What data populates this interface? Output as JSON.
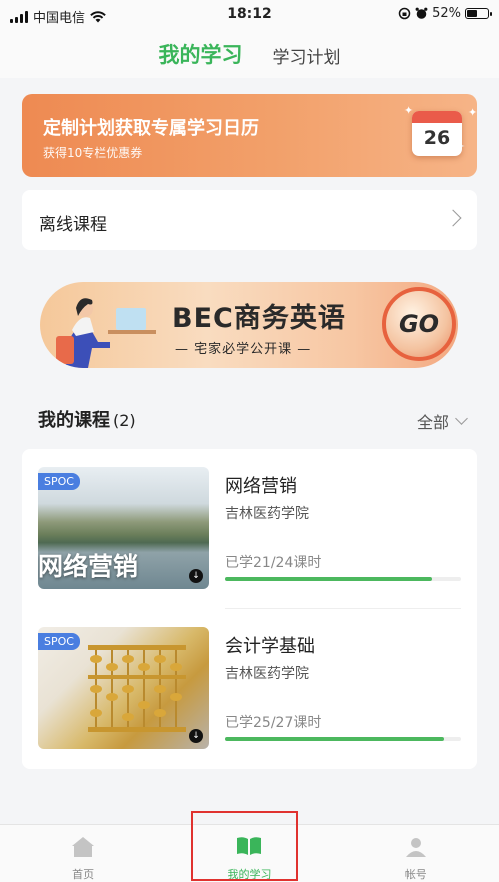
{
  "status_bar": {
    "carrier": "中国电信",
    "time": "18:12",
    "battery": "52%"
  },
  "top_tabs": {
    "active": "我的学习",
    "other": "学习计划"
  },
  "promo": {
    "title": "定制计划获取专属学习日历",
    "subtitle": "获得10专栏优惠券",
    "calendar_day": "26"
  },
  "offline": {
    "label": "离线课程"
  },
  "bec_banner": {
    "headline": "BEC商务英语",
    "subline": "— 宅家必学公开课 —",
    "go": "GO"
  },
  "section": {
    "title": "我的课程",
    "count": "(2)",
    "filter": "全部"
  },
  "courses": [
    {
      "tag": "SPOC",
      "thumb_title": "网络营销",
      "name": "网络营销",
      "school": "吉林医药学院",
      "progress_text": "已学21/24课时",
      "progress": 0.875
    },
    {
      "tag": "SPOC",
      "thumb_title": "",
      "name": "会计学基础",
      "school": "吉林医药学院",
      "progress_text": "已学25/27课时",
      "progress": 0.926
    }
  ],
  "bottom_nav": [
    {
      "label": "首页",
      "icon": "home-icon"
    },
    {
      "label": "我的学习",
      "icon": "book-icon"
    },
    {
      "label": "帐号",
      "icon": "user-icon"
    }
  ],
  "colors": {
    "accent": "#3ab55a",
    "promo": "#ee8a52",
    "highlight": "#e0322f"
  }
}
